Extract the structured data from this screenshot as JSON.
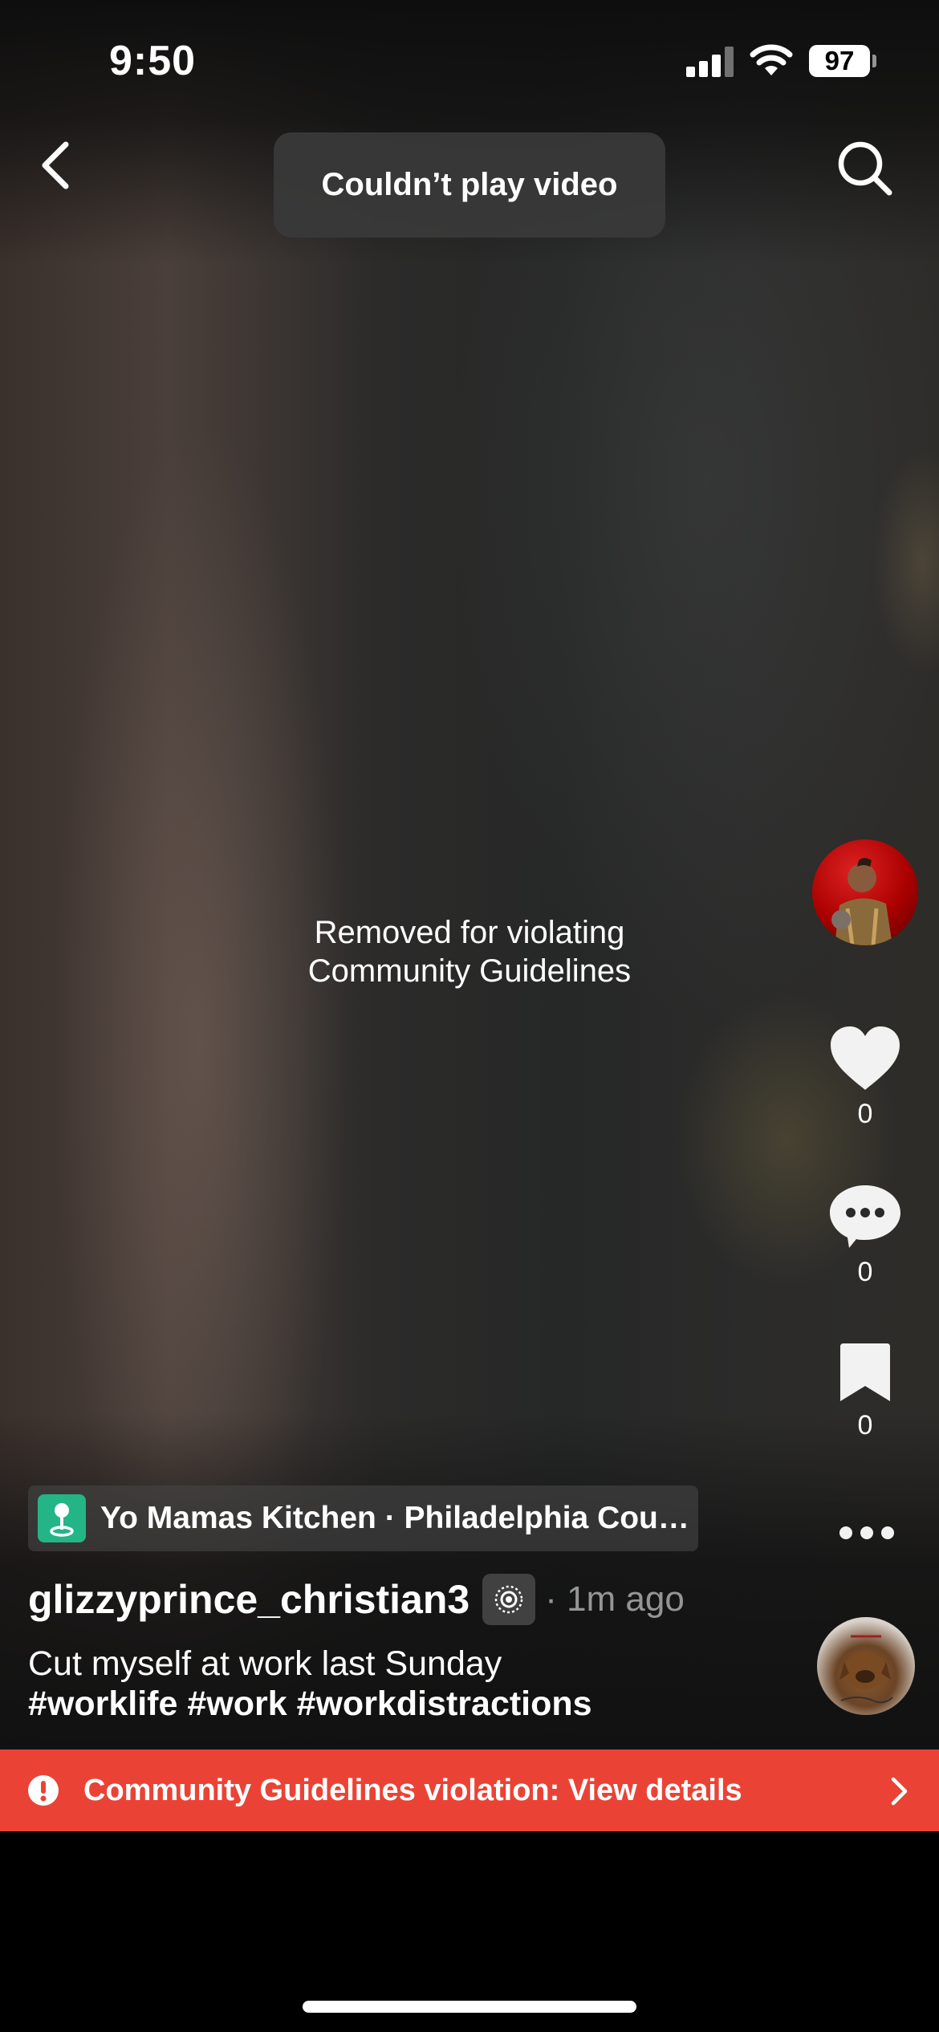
{
  "status_bar": {
    "time": "9:50",
    "battery": "97"
  },
  "toast": {
    "message": "Couldn’t play video"
  },
  "video": {
    "removed_message": "Removed for violating\nCommunity Guidelines"
  },
  "actions": {
    "likes": "0",
    "comments": "0",
    "saves": "0"
  },
  "location": {
    "label": "Yo Mamas Kitchen · Philadelphia Cou…"
  },
  "post": {
    "username": "glizzyprince_christian3",
    "time_ago": "· 1m ago",
    "caption": "Cut myself at work last Sunday",
    "hashtags": "#worklife #work #workdistractions"
  },
  "violation_banner": {
    "text": "Community Guidelines violation: View details"
  },
  "colors": {
    "violation_red": "#ea4335",
    "location_green": "#23b585"
  },
  "icons": [
    "back-chevron-icon",
    "search-icon",
    "heart-icon",
    "comment-icon",
    "bookmark-icon",
    "more-dots-icon",
    "alert-icon",
    "chevron-right-icon"
  ]
}
